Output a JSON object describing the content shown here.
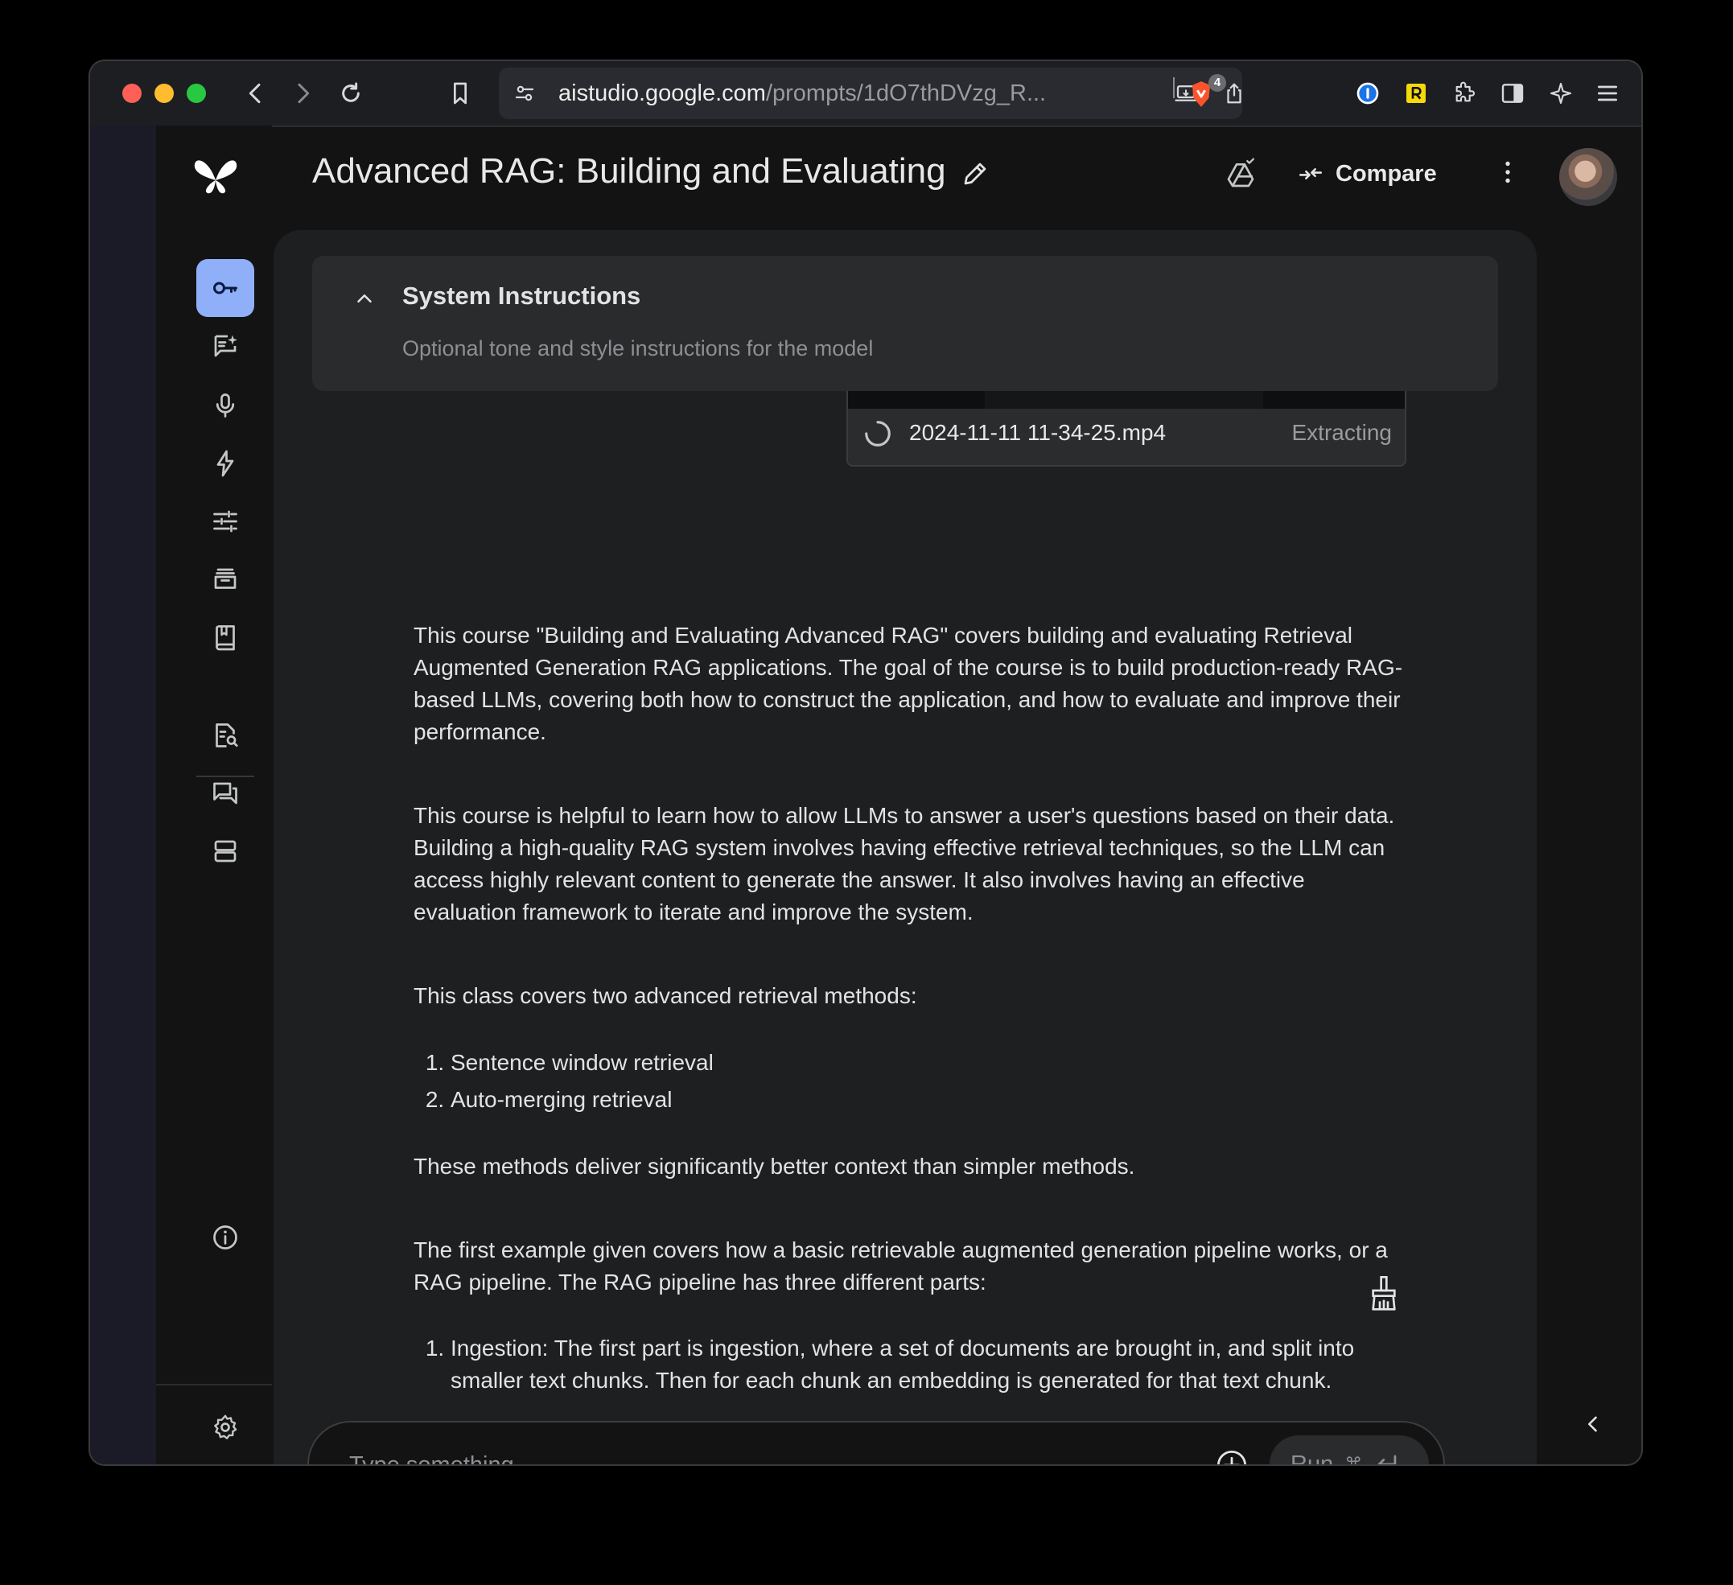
{
  "browser": {
    "url_host": "aistudio.google.com",
    "url_path": "/prompts/1dO7thDVzg_R...",
    "extensions_badge": "4"
  },
  "header": {
    "title": "Advanced RAG: Building and Evaluating",
    "compare_label": "Compare"
  },
  "sidebar": {
    "items": [
      {
        "icon": "key-icon",
        "active": true
      },
      {
        "icon": "new-prompt-icon"
      },
      {
        "icon": "mic-icon"
      },
      {
        "icon": "bolt-icon"
      },
      {
        "icon": "tune-icon"
      },
      {
        "icon": "archive-icon"
      },
      {
        "icon": "book-icon"
      },
      {
        "icon": "doc-search-icon"
      },
      {
        "icon": "chat-icon"
      },
      {
        "icon": "storage-icon"
      },
      {
        "icon": "info-icon"
      },
      {
        "icon": "settings-icon"
      },
      {
        "icon": "expand-icon"
      }
    ]
  },
  "system_instructions": {
    "title": "System Instructions",
    "placeholder": "Optional tone and style instructions for the model"
  },
  "attachment": {
    "file_name": "2024-11-11 11-34-25.mp4",
    "status": "Extracting"
  },
  "content": {
    "p1": "This course \"Building and Evaluating Advanced RAG\" covers building and evaluating Retrieval Augmented Generation RAG applications. The goal of the course is to build production-ready RAG-based LLMs, covering both how to construct the application, and how to evaluate and improve their performance.",
    "p2": "This course is helpful to learn how to allow LLMs to answer a user's questions based on their data. Building a high-quality RAG system involves having effective retrieval techniques, so the LLM can access highly relevant content to generate the answer. It also involves having an effective evaluation framework to iterate and improve the system.",
    "p3": "This class covers two advanced retrieval methods:",
    "list1": [
      "Sentence window retrieval",
      "Auto-merging retrieval"
    ],
    "p4": "These methods deliver significantly better context than simpler methods.",
    "p5": "The first example given covers how a basic retrievable augmented generation pipeline works, or a RAG pipeline. The RAG pipeline has three different parts:",
    "list2": [
      "Ingestion: The first part is ingestion, where a set of documents are brought in, and split into smaller text chunks. Then for each chunk an embedding is generated for that text chunk."
    ]
  },
  "input": {
    "placeholder": "Type something",
    "run_label": "Run",
    "run_shortcut": "⌘"
  },
  "colors": {
    "accent": "#8fb0f8",
    "panel": "#1e1f20",
    "background": "#131314"
  }
}
